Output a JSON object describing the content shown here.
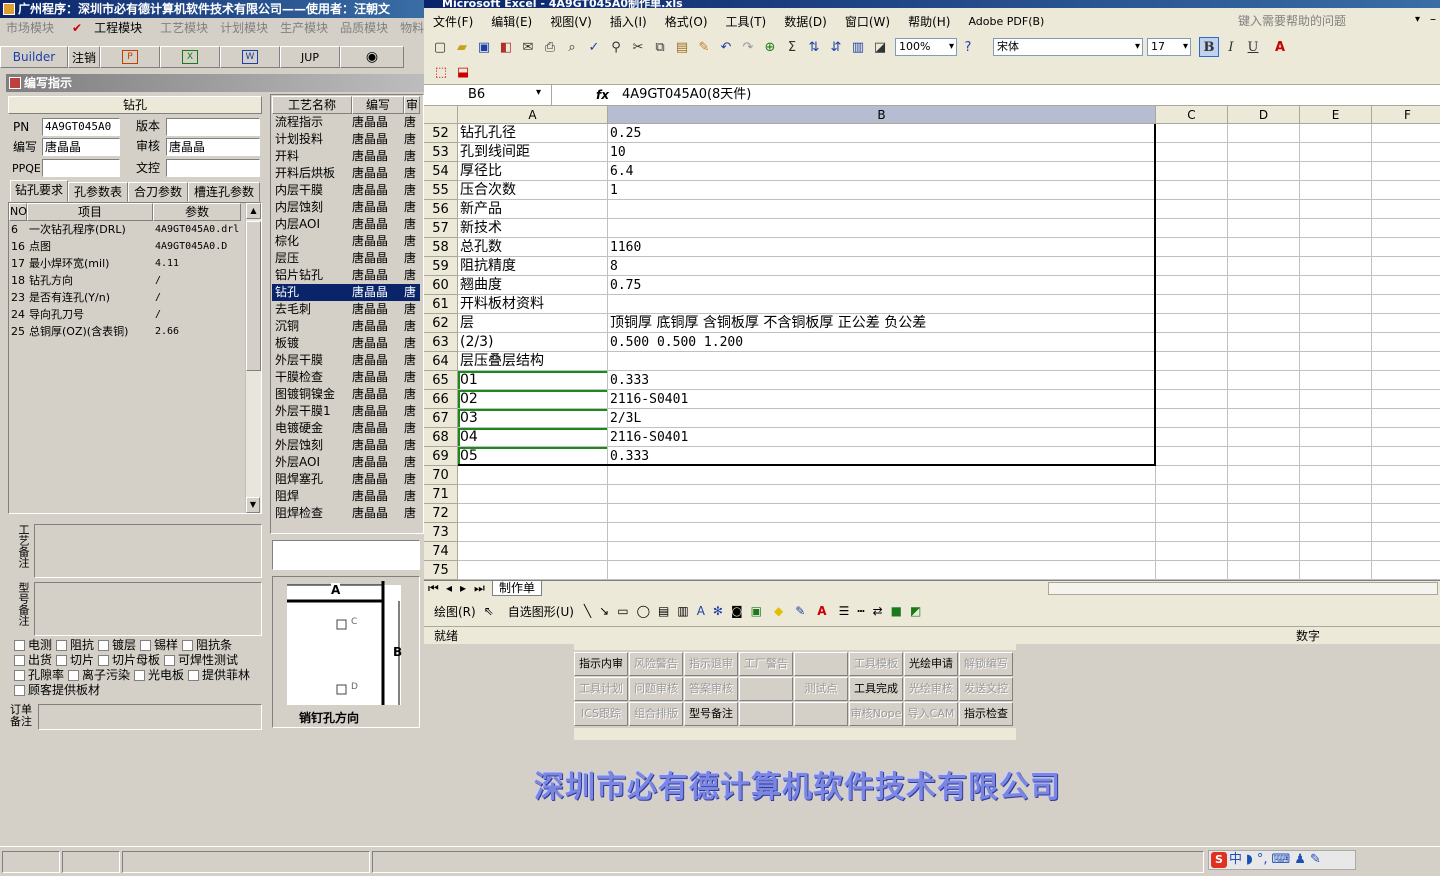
{
  "left_app": {
    "title": "广州程序：深圳市必有德计算机软件技术有限公司——使用者：汪朝文",
    "modules": [
      "市场模块",
      "工程模块",
      "工艺模块",
      "计划模块",
      "生产模块",
      "品质模块",
      "物料模"
    ],
    "toolbar": {
      "builder": "Builder",
      "logout": "注销",
      "jup": "JUP"
    },
    "panel_title": "编写指示",
    "section_title": "钻孔",
    "form": {
      "pn_label": "PN",
      "pn_value": "4A9GT045A0",
      "version_label": "版本",
      "version_value": "",
      "editor_label": "编写",
      "editor_value": "唐晶晶",
      "reviewer_label": "审核",
      "reviewer_value": "唐晶晶",
      "ppqe_label": "PPQE",
      "ppqe_value": "",
      "doc_label": "文控",
      "doc_value": ""
    },
    "tabs": [
      "钻孔要求",
      "孔参数表",
      "合刀参数",
      "槽连孔参数"
    ],
    "param_table": {
      "headers": [
        "NO",
        "项目",
        "参数"
      ],
      "rows": [
        {
          "no": "6",
          "item": "一次钻孔程序(DRL)",
          "value": "4A9GT045A0.drl"
        },
        {
          "no": "16",
          "item": "点图",
          "value": "4A9GT045A0.D"
        },
        {
          "no": "17",
          "item": "最小焊环宽(mil)",
          "value": "4.11"
        },
        {
          "no": "18",
          "item": "钻孔方向",
          "value": "/"
        },
        {
          "no": "23",
          "item": "是否有连孔(Y/n)",
          "value": "/"
        },
        {
          "no": "24",
          "item": "导向孔刀号",
          "value": "/"
        },
        {
          "no": "25",
          "item": "总铜厚(OZ)(含表铜)",
          "value": "2.66"
        }
      ]
    },
    "process_note_label": "工艺备注",
    "model_note_label": "型号备注",
    "order_note_label": "订单备注",
    "checkboxes_row1": [
      "电测",
      "阻抗",
      "镀层",
      "锡样",
      "阻抗条"
    ],
    "checkboxes_row2": [
      "出货",
      "切片",
      "切片母板",
      "可焊性测试"
    ],
    "checkboxes_row3": [
      "孔隙率",
      "离子污染",
      "光电板",
      "提供菲林"
    ],
    "checkboxes_row4": [
      "顾客提供板材"
    ],
    "process_list": {
      "headers": [
        "工艺名称",
        "编写",
        "审"
      ],
      "rows": [
        {
          "name": "流程指示",
          "editor": "唐晶晶",
          "rev": "唐"
        },
        {
          "name": "计划投料",
          "editor": "唐晶晶",
          "rev": "唐"
        },
        {
          "name": "开料",
          "editor": "唐晶晶",
          "rev": "唐"
        },
        {
          "name": "开料后烘板",
          "editor": "唐晶晶",
          "rev": "唐"
        },
        {
          "name": "内层干膜",
          "editor": "唐晶晶",
          "rev": "唐"
        },
        {
          "name": "内层蚀刻",
          "editor": "唐晶晶",
          "rev": "唐"
        },
        {
          "name": "内层AOI",
          "editor": "唐晶晶",
          "rev": "唐"
        },
        {
          "name": "棕化",
          "editor": "唐晶晶",
          "rev": "唐"
        },
        {
          "name": "层压",
          "editor": "唐晶晶",
          "rev": "唐"
        },
        {
          "name": "铝片钻孔",
          "editor": "唐晶晶",
          "rev": "唐"
        },
        {
          "name": "钻孔",
          "editor": "唐晶晶",
          "rev": "唐"
        },
        {
          "name": "去毛刺",
          "editor": "唐晶晶",
          "rev": "唐"
        },
        {
          "name": "沉铜",
          "editor": "唐晶晶",
          "rev": "唐"
        },
        {
          "name": "板镀",
          "editor": "唐晶晶",
          "rev": "唐"
        },
        {
          "name": "外层干膜",
          "editor": "唐晶晶",
          "rev": "唐"
        },
        {
          "name": "干膜检查",
          "editor": "唐晶晶",
          "rev": "唐"
        },
        {
          "name": "图镀铜镍金",
          "editor": "唐晶晶",
          "rev": "唐"
        },
        {
          "name": "外层干膜1",
          "editor": "唐晶晶",
          "rev": "唐"
        },
        {
          "name": "电镀硬金",
          "editor": "唐晶晶",
          "rev": "唐"
        },
        {
          "name": "外层蚀刻",
          "editor": "唐晶晶",
          "rev": "唐"
        },
        {
          "name": "外层AOI",
          "editor": "唐晶晶",
          "rev": "唐"
        },
        {
          "name": "阻焊塞孔",
          "editor": "唐晶晶",
          "rev": "唐"
        },
        {
          "name": "阻焊",
          "editor": "唐晶晶",
          "rev": "唐"
        },
        {
          "name": "阻焊检查",
          "editor": "唐晶晶",
          "rev": "唐"
        }
      ]
    },
    "diagram": {
      "label_a": "A",
      "label_b": "B",
      "label_c": "C",
      "label_d": "D",
      "caption": "销钉孔方向"
    }
  },
  "excel": {
    "title": "Microsoft Excel - 4A9GT045A0制作单.xls",
    "menu": [
      "文件(F)",
      "编辑(E)",
      "视图(V)",
      "插入(I)",
      "格式(O)",
      "工具(T)",
      "数据(D)",
      "窗口(W)",
      "帮助(H)",
      "Adobe PDF(B)"
    ],
    "help_placeholder": "键入需要帮助的问题",
    "zoom": "100%",
    "font_name": "宋体",
    "font_size": "17",
    "name_box": "B6",
    "fx": "fx",
    "formula_value": "4A9GT045A0(8天件)",
    "columns": [
      "A",
      "B",
      "C",
      "D",
      "E",
      "F"
    ],
    "rows": [
      {
        "n": "52",
        "a": "钻孔孔径",
        "b": "0.25"
      },
      {
        "n": "53",
        "a": "孔到线间距",
        "b": "10"
      },
      {
        "n": "54",
        "a": "厚径比",
        "b": "6.4"
      },
      {
        "n": "55",
        "a": "压合次数",
        "b": "1"
      },
      {
        "n": "56",
        "a": "新产品",
        "b": ""
      },
      {
        "n": "57",
        "a": "新技术",
        "b": ""
      },
      {
        "n": "58",
        "a": "总孔数",
        "b": "1160"
      },
      {
        "n": "59",
        "a": "阻抗精度",
        "b": "8"
      },
      {
        "n": "60",
        "a": "翘曲度",
        "b": "0.75"
      },
      {
        "n": "61",
        "a": "开料板材资料",
        "b": ""
      },
      {
        "n": "62",
        "a": "层",
        "b": "顶铜厚 底铜厚 含铜板厚 不含铜板厚 正公差 负公差"
      },
      {
        "n": "63",
        "a": "(2/3)",
        "b": "0.500  0.500   1.200"
      },
      {
        "n": "64",
        "a": "层压叠层结构",
        "b": ""
      },
      {
        "n": "65",
        "a": "01",
        "b": "0.333"
      },
      {
        "n": "66",
        "a": "02",
        "b": "2116-S0401"
      },
      {
        "n": "67",
        "a": "03",
        "b": "2/3L"
      },
      {
        "n": "68",
        "a": "04",
        "b": "2116-S0401"
      },
      {
        "n": "69",
        "a": "05",
        "b": "0.333"
      },
      {
        "n": "70",
        "a": "",
        "b": ""
      },
      {
        "n": "71",
        "a": "",
        "b": ""
      },
      {
        "n": "72",
        "a": "",
        "b": ""
      },
      {
        "n": "73",
        "a": "",
        "b": ""
      },
      {
        "n": "74",
        "a": "",
        "b": ""
      },
      {
        "n": "75",
        "a": "",
        "b": ""
      }
    ],
    "sheet_tab": "制作单",
    "draw_label": "绘图(R)",
    "autoshape_label": "自选图形(U)",
    "status_left": "就绪",
    "status_right": "数字"
  },
  "grid_buttons": [
    {
      "label": "指示内审",
      "enabled": true
    },
    {
      "label": "风险警告",
      "enabled": false
    },
    {
      "label": "指示退审",
      "enabled": false
    },
    {
      "label": "工厂警告",
      "enabled": false
    },
    {
      "label": "",
      "enabled": false
    },
    {
      "label": "工具模板",
      "enabled": false
    },
    {
      "label": "光绘申请",
      "enabled": true
    },
    {
      "label": "解锁编写",
      "enabled": false
    },
    {
      "label": "工具计划",
      "enabled": false
    },
    {
      "label": "问题审核",
      "enabled": false
    },
    {
      "label": "答案审核",
      "enabled": false
    },
    {
      "label": "",
      "enabled": false
    },
    {
      "label": "测试点",
      "enabled": false
    },
    {
      "label": "工具完成",
      "enabled": true
    },
    {
      "label": "光绘审核",
      "enabled": false
    },
    {
      "label": "发送文控",
      "enabled": false
    },
    {
      "label": "ICS跟踪",
      "enabled": false
    },
    {
      "label": "组合排版",
      "enabled": false
    },
    {
      "label": "型号备注",
      "enabled": true
    },
    {
      "label": "",
      "enabled": false
    },
    {
      "label": "",
      "enabled": false
    },
    {
      "label": "审核Nope",
      "enabled": false
    },
    {
      "label": "导入CAM",
      "enabled": false
    },
    {
      "label": "指示检查",
      "enabled": true
    }
  ],
  "company_banner": "深圳市必有德计算机软件技术有限公司",
  "ime": {
    "label": "中"
  }
}
